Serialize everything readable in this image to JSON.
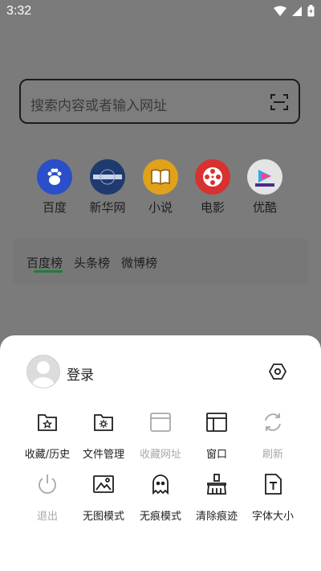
{
  "status_bar": {
    "time": "3:32",
    "icons": [
      "wifi-icon",
      "signal-icon",
      "battery-icon"
    ]
  },
  "search": {
    "placeholder": "搜索内容或者输入网址",
    "icon": "scan-icon"
  },
  "quick_links": [
    {
      "label": "百度",
      "icon": "baidu-paw-icon",
      "color": "#2b4ec9"
    },
    {
      "label": "新华网",
      "icon": "china-news-icon",
      "color": "#1e3a6e"
    },
    {
      "label": "小说",
      "icon": "book-icon",
      "color": "#e0a21b"
    },
    {
      "label": "电影",
      "icon": "film-reel-icon",
      "color": "#d93030"
    },
    {
      "label": "优酷",
      "icon": "youku-icon",
      "color": "#e4e4e4"
    }
  ],
  "hot_lists": {
    "tabs": [
      "百度榜",
      "头条榜",
      "微博榜"
    ],
    "selected": "百度榜",
    "accent": "#1f7d3a"
  },
  "sheet": {
    "login_label": "登录",
    "row1": [
      {
        "label": "收藏/历史",
        "icon": "folder-star-icon",
        "enabled": true
      },
      {
        "label": "文件管理",
        "icon": "folder-gear-icon",
        "enabled": true
      },
      {
        "label": "收藏网址",
        "icon": "browser-window-icon",
        "enabled": false
      },
      {
        "label": "窗口",
        "icon": "window-layout-icon",
        "enabled": true
      },
      {
        "label": "刷新",
        "icon": "refresh-icon",
        "enabled": false
      }
    ],
    "row2": [
      {
        "label": "退出",
        "icon": "power-icon",
        "enabled": false
      },
      {
        "label": "无图模式",
        "icon": "image-icon",
        "enabled": true
      },
      {
        "label": "无痕模式",
        "icon": "ghost-icon",
        "enabled": true
      },
      {
        "label": "清除痕迹",
        "icon": "broom-icon",
        "enabled": true
      },
      {
        "label": "字体大小",
        "icon": "font-document-icon",
        "enabled": true
      }
    ]
  }
}
